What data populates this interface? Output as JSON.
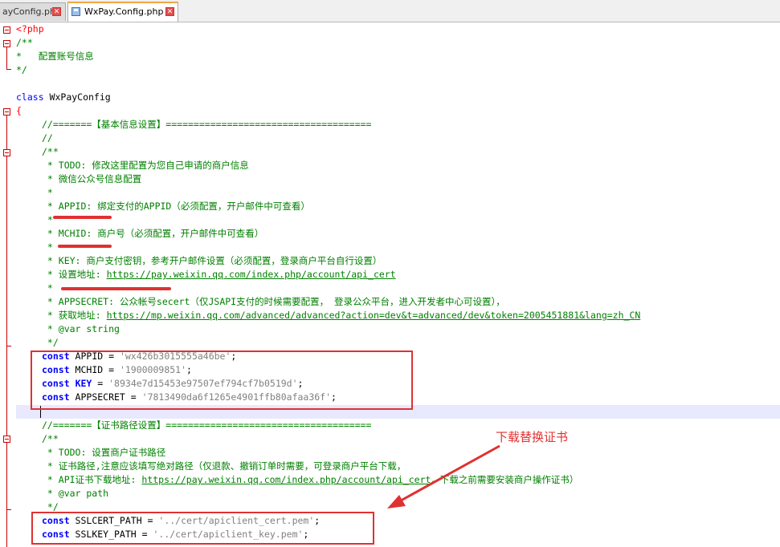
{
  "tabs": [
    {
      "label": "ayConfig.php",
      "active": false
    },
    {
      "label": "WxPay.Config.php",
      "active": true
    }
  ],
  "code": {
    "php_open": "<?php",
    "doc1_open": "/**",
    "doc1_line": "*   配置账号信息",
    "doc1_close": "*/",
    "class_kw": "class",
    "class_name": " WxPayConfig",
    "brace_open": "{",
    "section1": "//=======【基本信息设置】=====================================",
    "slashes": "//",
    "doc2_open": "/**",
    "todo": " * TODO: 修改这里配置为您自己申请的商户信息",
    "wx_info": " * 微信公众号信息配置",
    "star1": " *",
    "appid_desc": " * APPID: 绑定支付的APPID（必须配置，开户邮件中可查看）",
    "star2": " *",
    "mchid_desc": " * MCHID: 商户号（必须配置，开户邮件中可查看）",
    "star3": " *",
    "key_desc": " * KEY: 商户支付密钥，参考开户邮件设置（必须配置，登录商户平台自行设置）",
    "key_url_prefix": " * 设置地址: ",
    "key_url": "https://pay.weixin.qq.com/index.php/account/api_cert",
    "star4": " *",
    "appsecret_desc": " * APPSECRET: 公众帐号secert（仅JSAPI支付的时候需要配置， 登录公众平台，进入开发者中心可设置），",
    "secret_url_prefix": " * 获取地址: ",
    "secret_url": "https://mp.weixin.qq.com/advanced/advanced?action=dev&t=advanced/dev&token=2005451881&lang=zh_CN",
    "var_string": " * @var string",
    "doc2_close": " */",
    "const_kw": "const",
    "appid_name": " APPID = ",
    "appid_val": "'wx426b3015555a46be'",
    "mchid_name": " MCHID = ",
    "mchid_val": "'1900009851'",
    "key_kw": "KEY",
    "key_eq": " = ",
    "key_val": "'8934e7d15453e97507ef794cf7b0519d'",
    "secret_name": " APPSECRET = ",
    "secret_val": "'7813490da6f1265e4901ffb80afaa36f'",
    "section2": "//=======【证书路径设置】=====================================",
    "doc3_open": "/**",
    "todo2": " * TODO: 设置商户证书路径",
    "cert_desc": " * 证书路径,注意应该填写绝对路径（仅退款、撤销订单时需要，可登录商户平台下载，",
    "api_cert_prefix": " * API证书下载地址: ",
    "api_cert_url": "https://pay.weixin.qq.com/index.php/account/api_cert",
    "api_cert_suffix": "，下载之前需要安装商户操作证书）",
    "var_path": " * @var path",
    "doc3_close": " */",
    "sslcert_name": " SSLCERT_PATH = ",
    "sslcert_val": "'../cert/apiclient_cert.pem'",
    "sslkey_name": " SSLKEY_PATH = ",
    "sslkey_val": "'../cert/apiclient_key.pem'",
    "semi": ";"
  },
  "annotation": {
    "label": "下载替换证书",
    "color": "#e03131"
  }
}
